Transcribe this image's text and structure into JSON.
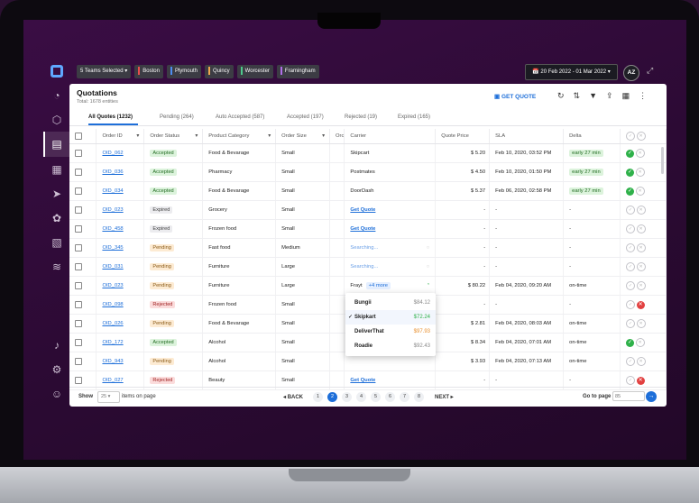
{
  "topbar": {
    "teams_selected": "5 Teams Selected",
    "teams": [
      {
        "label": "Boston",
        "color": "#e84e4e"
      },
      {
        "label": "Plymouth",
        "color": "#4e8cf0"
      },
      {
        "label": "Quincy",
        "color": "#f0a64e"
      },
      {
        "label": "Worcester",
        "color": "#4ec98c"
      },
      {
        "label": "Framingham",
        "color": "#b06ee8"
      }
    ],
    "date_range": "20 Feb 2022 - 01 Mar 2022",
    "avatar": "AZ"
  },
  "sidebar": {
    "icons": [
      "dashboard-icon",
      "cube-icon",
      "document-icon",
      "calendar-icon",
      "send-icon",
      "settings-icon",
      "file-money-icon",
      "database-icon",
      "bell-icon",
      "gear-icon",
      "help-icon"
    ]
  },
  "header": {
    "title": "Quotations",
    "subtitle": "Total: 1678 entities",
    "get_quote": "GET QUOTE"
  },
  "tabs": [
    {
      "label": "All Quotes (1232)"
    },
    {
      "label": "Pending (264)"
    },
    {
      "label": "Auto Accepted (587)"
    },
    {
      "label": "Accepted (197)"
    },
    {
      "label": "Rejected (19)"
    },
    {
      "label": "Expired (165)"
    }
  ],
  "columns": [
    "Order ID",
    "Order Status",
    "Product Category",
    "Order Size",
    "Orc",
    "Carrier",
    "Quote Price",
    "SLA",
    "Delta"
  ],
  "rows": [
    {
      "id": "OID_062",
      "status": "Accepted",
      "category": "Food & Bevarage",
      "size": "Small",
      "carrier": "Skipcart",
      "price": "$ 5.20",
      "sla": "Feb 10, 2020, 03:52 PM",
      "delta": "early 27 min",
      "action": "ok"
    },
    {
      "id": "OID_036",
      "status": "Accepted",
      "category": "Pharmacy",
      "size": "Small",
      "carrier": "Postmates",
      "price": "$ 4.50",
      "sla": "Feb 10, 2020, 01:50 PM",
      "delta": "early 27 min",
      "action": "ok"
    },
    {
      "id": "OID_034",
      "status": "Accepted",
      "category": "Food & Bevarage",
      "size": "Small",
      "carrier": "DoorDash",
      "price": "$ 5.37",
      "sla": "Feb 06, 2020, 02:58 PM",
      "delta": "early 27 min",
      "action": "ok"
    },
    {
      "id": "OID_023",
      "status": "Expired",
      "category": "Grocery",
      "size": "Small",
      "carrier": "Get Quote",
      "price": "-",
      "sla": "-",
      "delta": "-",
      "action": "none"
    },
    {
      "id": "OID_458",
      "status": "Expired",
      "category": "Frozen food",
      "size": "Small",
      "carrier": "Get Quote",
      "price": "-",
      "sla": "-",
      "delta": "-",
      "action": "none"
    },
    {
      "id": "OID_345",
      "status": "Pending",
      "category": "Fast food",
      "size": "Medium",
      "carrier": "Searching...",
      "price": "-",
      "sla": "-",
      "delta": "-",
      "action": "none"
    },
    {
      "id": "OID_031",
      "status": "Pending",
      "category": "Furniture",
      "size": "Large",
      "carrier": "Searching...",
      "price": "-",
      "sla": "-",
      "delta": "-",
      "action": "none"
    },
    {
      "id": "OID_023",
      "status": "Pending",
      "category": "Furniture",
      "size": "Large",
      "carrier": "Frayt",
      "more": "+4 more",
      "price": "$ 80.22",
      "sla": "Feb 04, 2020, 09:20 AM",
      "delta": "on-time",
      "action": "none"
    },
    {
      "id": "OID_098",
      "status": "Rejected",
      "category": "Frozen food",
      "size": "Small",
      "carrier": "",
      "price": "-",
      "sla": "-",
      "delta": "-",
      "action": "x"
    },
    {
      "id": "OID_026",
      "status": "Pending",
      "category": "Food & Bevarage",
      "size": "Small",
      "carrier": "",
      "price": "$ 2.81",
      "sla": "Feb 04, 2020, 08:03 AM",
      "delta": "on-time",
      "action": "none"
    },
    {
      "id": "OID_172",
      "status": "Accepted",
      "category": "Alcohol",
      "size": "Small",
      "carrier": "",
      "price": "$ 8.34",
      "sla": "Feb 04, 2020, 07:01 AM",
      "delta": "on-time",
      "action": "ok"
    },
    {
      "id": "OID_943",
      "status": "Pending",
      "category": "Alcohol",
      "size": "Small",
      "carrier": "",
      "price": "$ 3.93",
      "sla": "Feb 04, 2020, 07:13 AM",
      "delta": "on-time",
      "action": "none"
    },
    {
      "id": "OID_027",
      "status": "Rejected",
      "category": "Beauty",
      "size": "Small",
      "carrier": "Get Quote",
      "price": "-",
      "sla": "-",
      "delta": "-",
      "action": "x"
    }
  ],
  "carrier_dropdown": [
    {
      "name": "Bungii",
      "price": "$84.12",
      "color": "#888888",
      "selected": false
    },
    {
      "name": "Skipkart",
      "price": "$72.24",
      "color": "#2fb14a",
      "selected": true
    },
    {
      "name": "DeliverThat",
      "price": "$97.93",
      "color": "#e8902f",
      "selected": false
    },
    {
      "name": "Roadie",
      "price": "$92.43",
      "color": "#888888",
      "selected": false
    }
  ],
  "footer": {
    "show": "Show",
    "per_page": "25",
    "items_on_page": "items on page",
    "back": "BACK",
    "next": "NEXT",
    "pages": [
      "1",
      "2",
      "3",
      "4",
      "5",
      "6",
      "7",
      "8"
    ],
    "current_page": "2",
    "go_to_page": "Go to page",
    "go_placeholder": "85"
  }
}
